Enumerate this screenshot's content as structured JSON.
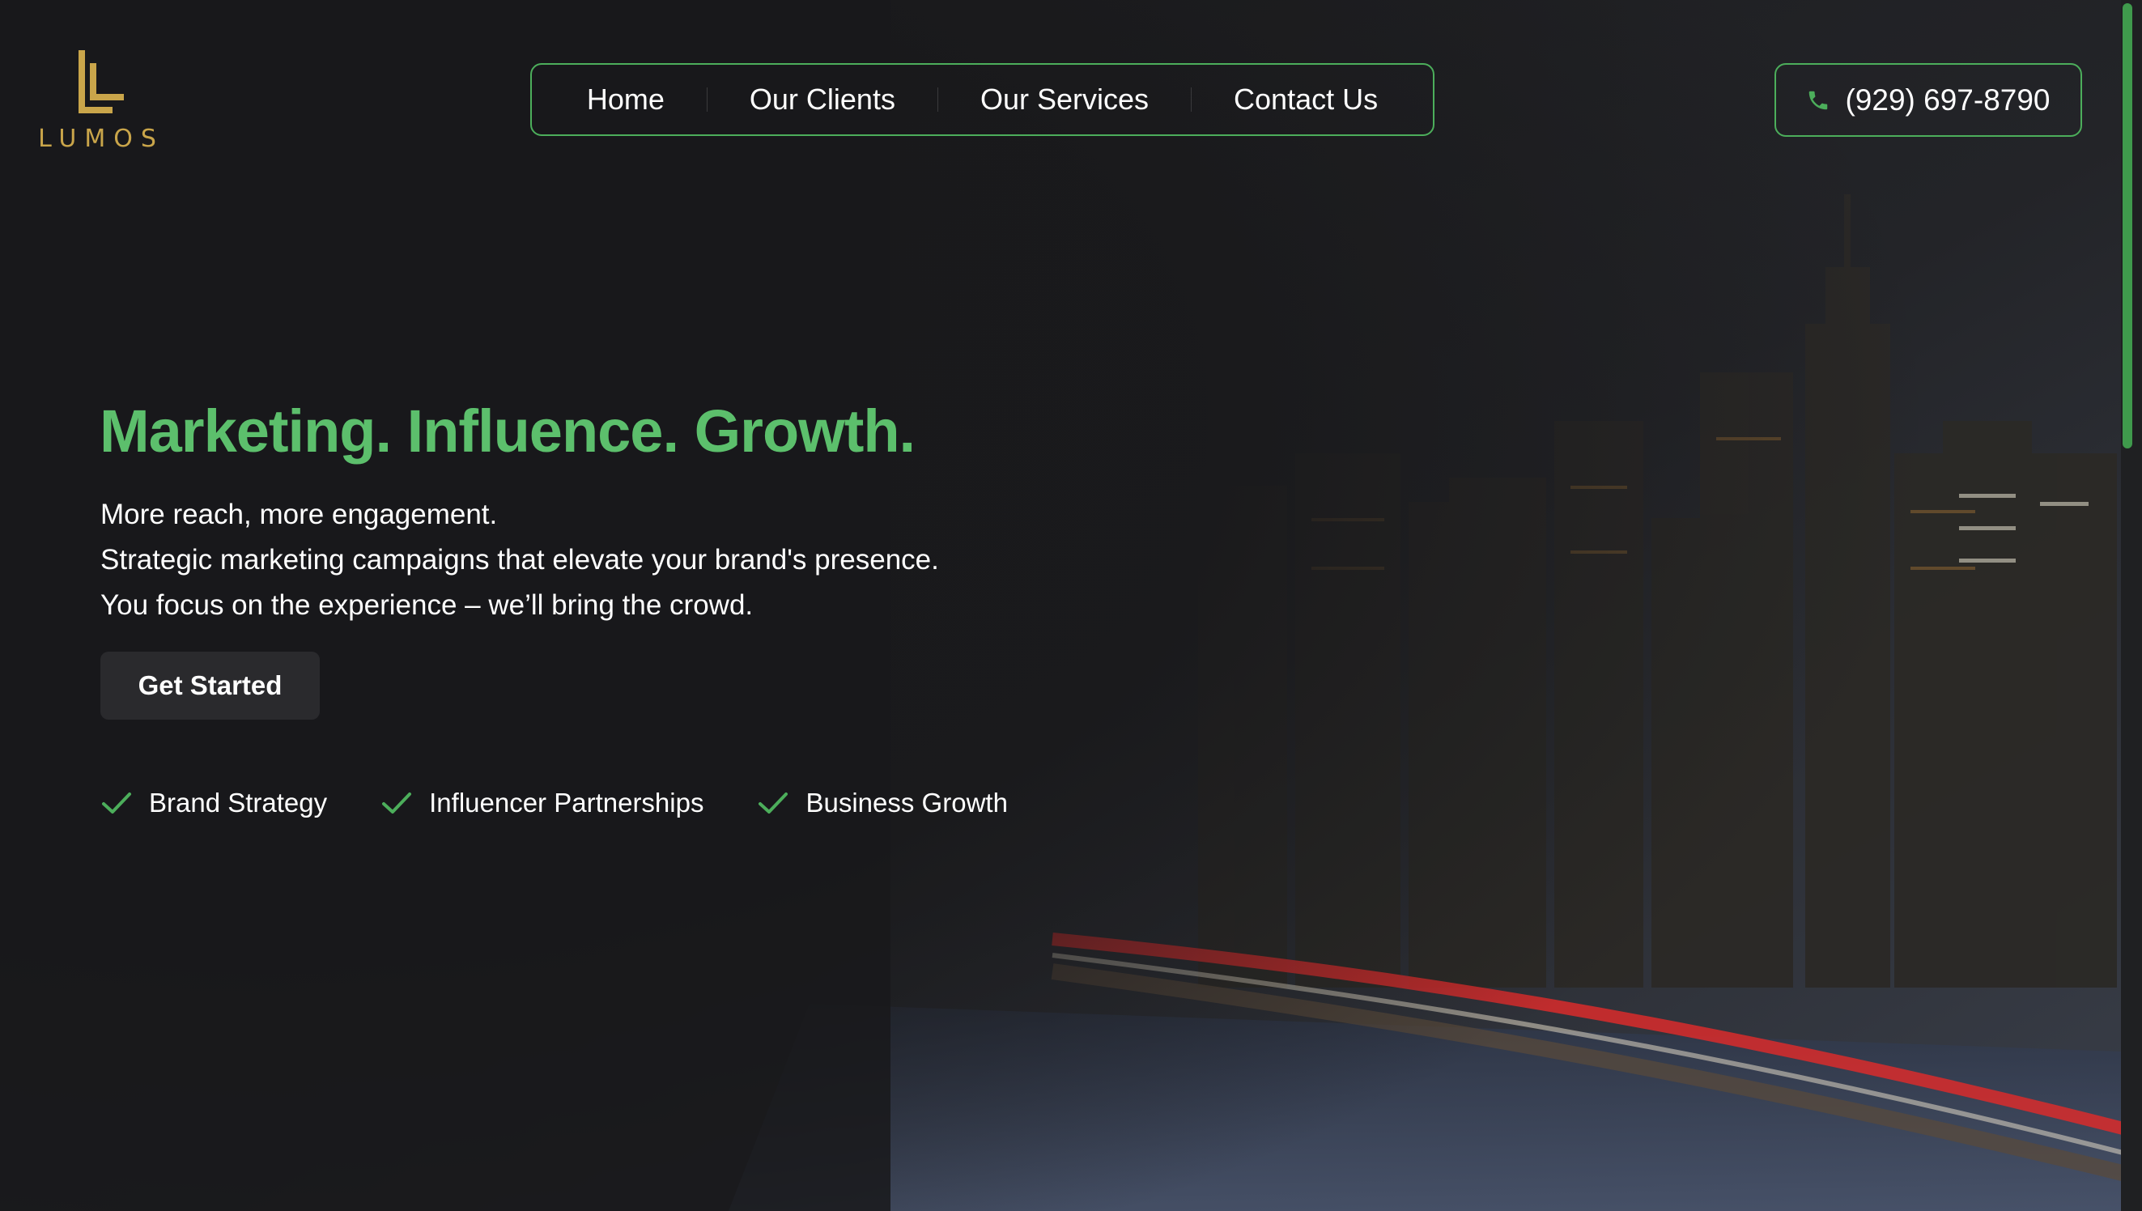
{
  "brand": {
    "name": "LUMOS",
    "logo_icon": "lumos-l-logo",
    "gold": "#c9a54a"
  },
  "nav": {
    "items": [
      {
        "label": "Home"
      },
      {
        "label": "Our Clients"
      },
      {
        "label": "Our Services"
      },
      {
        "label": "Contact Us"
      }
    ]
  },
  "phone": {
    "icon": "phone-icon",
    "number": "(929) 697-8790"
  },
  "hero": {
    "headline": "Marketing. Influence. Growth.",
    "lines": [
      "More reach, more engagement.",
      "Strategic marketing campaigns that elevate your brand's presence.",
      "You focus on the experience – we’ll bring the crowd."
    ],
    "cta_label": "Get Started",
    "features": [
      {
        "icon": "check-icon",
        "label": "Brand Strategy"
      },
      {
        "icon": "check-icon",
        "label": "Influencer Partnerships"
      },
      {
        "icon": "check-icon",
        "label": "Business Growth"
      }
    ]
  },
  "colors": {
    "accent": "#5cbf6c",
    "border": "#4cae5b",
    "background": "#19191b",
    "button": "#2a2a2d"
  }
}
